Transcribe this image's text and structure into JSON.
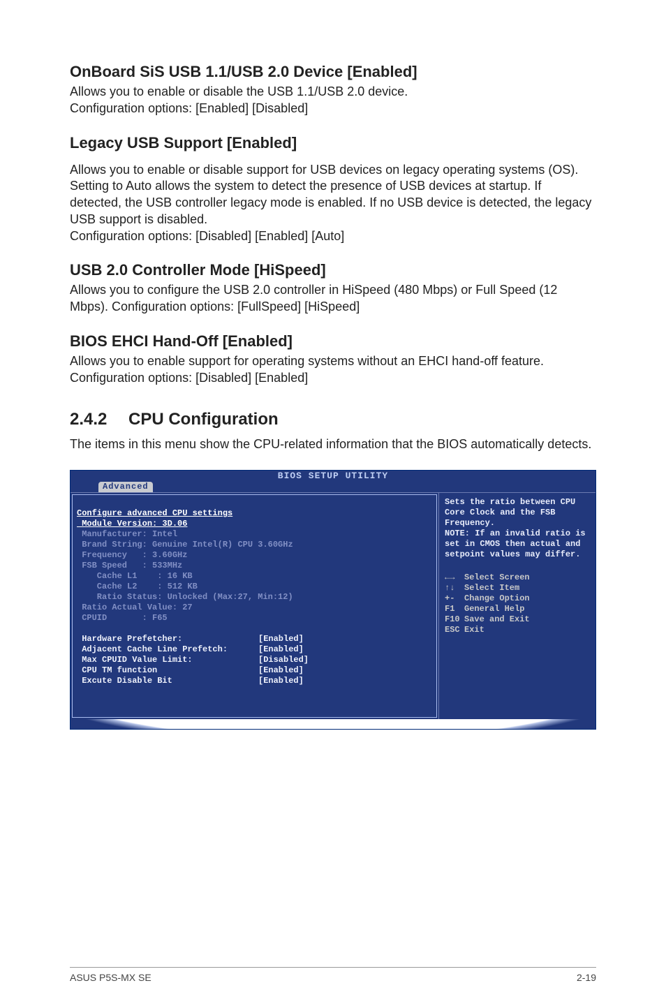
{
  "sections": [
    {
      "title": "OnBoard SiS USB 1.1/USB 2.0 Device [Enabled]",
      "body": "Allows you to enable or disable the USB 1.1/USB 2.0 device.\nConfiguration options: [Enabled] [Disabled]"
    },
    {
      "title": "Legacy USB Support [Enabled]",
      "body": "Allows you to enable or disable support for USB devices on legacy operating systems (OS). Setting to Auto allows the system to detect the presence of USB devices at startup. If detected, the USB controller legacy mode is enabled. If no USB device is detected, the legacy USB support is disabled.\nConfiguration options: [Disabled] [Enabled] [Auto]"
    },
    {
      "title": "USB 2.0 Controller Mode [HiSpeed]",
      "body": "Allows you to configure the USB 2.0 controller in HiSpeed (480 Mbps) or Full Speed (12 Mbps). Configuration options: [FullSpeed] [HiSpeed]"
    },
    {
      "title": "BIOS EHCI Hand-Off [Enabled]",
      "body": "Allows you to enable support for operating systems without an EHCI hand-off feature. Configuration options: [Disabled] [Enabled]"
    }
  ],
  "numbered": {
    "num": "2.4.2",
    "title": "CPU Configuration",
    "body": "The items in this menu show the CPU-related information that the BIOS automatically detects."
  },
  "bios": {
    "title": "BIOS SETUP UTILITY",
    "tab": "Advanced",
    "header_line": "Configure advanced CPU settings",
    "module_line": " Module Version: 3D.06",
    "dim_lines": [
      " Manufacturer: Intel",
      " Brand String: Genuine Intel(R) CPU 3.60GHz",
      " Frequency   : 3.60GHz",
      " FSB Speed   : 533MHz",
      "    Cache L1    : 16 KB",
      "    Cache L2    : 512 KB",
      "    Ratio Status: Unlocked (Max:27, Min:12)",
      " Ratio Actual Value: 27",
      " CPUID       : F65"
    ],
    "options": [
      {
        "label": " Hardware Prefetcher:",
        "value": "[Enabled]"
      },
      {
        "label": " Adjacent Cache Line Prefetch:",
        "value": "[Enabled]"
      },
      {
        "label": " Max CPUID Value Limit:",
        "value": "[Disabled]"
      },
      {
        "label": " CPU TM function",
        "value": "[Enabled]"
      },
      {
        "label": " Excute Disable Bit",
        "value": "[Enabled]"
      }
    ],
    "help_text": "Sets the ratio between CPU Core Clock and the FSB Frequency.\nNOTE: If an invalid ratio is set in CMOS then actual and setpoint values may differ.",
    "nav": [
      {
        "key": "←→",
        "action": "Select Screen"
      },
      {
        "key": "↑↓",
        "action": "Select Item"
      },
      {
        "key": "+-",
        "action": "Change Option"
      },
      {
        "key": "F1",
        "action": "General Help"
      },
      {
        "key": "F10",
        "action": "Save and Exit"
      },
      {
        "key": "ESC",
        "action": "Exit"
      }
    ]
  },
  "footer": {
    "left": "ASUS P5S-MX SE",
    "right": "2-19"
  }
}
